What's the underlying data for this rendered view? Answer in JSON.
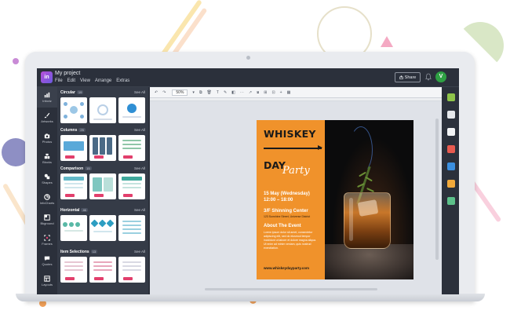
{
  "app": {
    "logo_text": "in",
    "project_name": "My project",
    "menu": [
      "File",
      "Edit",
      "View",
      "Arrange",
      "Extras"
    ],
    "share_label": "Share",
    "avatar_initial": "V"
  },
  "sidebar": {
    "items": [
      {
        "label": "Infoviz",
        "icon": "infographic-icon"
      },
      {
        "label": "Artworks",
        "icon": "brush-icon"
      },
      {
        "label": "Photos",
        "icon": "camera-icon"
      },
      {
        "label": "Blocks",
        "icon": "blocks-icon"
      },
      {
        "label": "Shapes",
        "icon": "shapes-icon"
      },
      {
        "label": "InfoCharts",
        "icon": "chart-icon"
      },
      {
        "label": "Bkground",
        "icon": "background-icon"
      },
      {
        "label": "Frames",
        "icon": "frame-icon"
      },
      {
        "label": "Quotes",
        "icon": "quote-icon"
      },
      {
        "label": "Layouts",
        "icon": "layout-icon"
      }
    ]
  },
  "panel": {
    "see_all": "See All",
    "sections": [
      {
        "title": "Circular",
        "count": "19"
      },
      {
        "title": "Columns",
        "count": "25"
      },
      {
        "title": "Comparison",
        "count": "15"
      },
      {
        "title": "Horizontal",
        "count": "46"
      },
      {
        "title": "Item Selections",
        "count": "13"
      }
    ]
  },
  "toolbar": {
    "zoom": "50%"
  },
  "poster": {
    "title": "WHISKEY",
    "day": "DAY",
    "party": "Party",
    "date": "15 May (Wednesday)",
    "time": "12:00 – 18:00",
    "venue": "3/F  Shinning Center",
    "venue_sub": "123 Sunshine Street, Universe District",
    "about_heading": "About The Event",
    "about_body": "Lorem ipsum dolor sit amet, consectetur adipiscing elit, sed do eiusmod tempor incididunt ut labore et dolore magna aliqua. Ut enim ad minim veniam, quis nostrud exercitation.",
    "url": "www.whiskeydayparty.com",
    "colors": {
      "accent": "#f0922b",
      "dark": "#0b0b0c"
    }
  }
}
